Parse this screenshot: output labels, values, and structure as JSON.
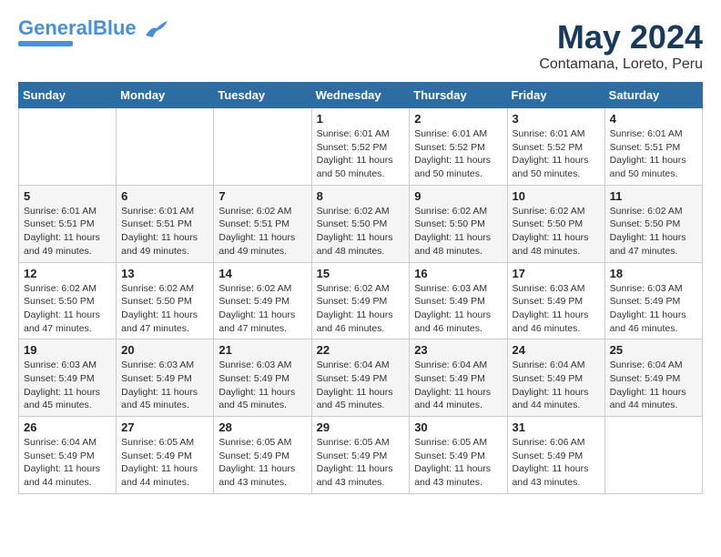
{
  "header": {
    "logo_general": "General",
    "logo_blue": "Blue",
    "month_title": "May 2024",
    "location": "Contamana, Loreto, Peru"
  },
  "days_of_week": [
    "Sunday",
    "Monday",
    "Tuesday",
    "Wednesday",
    "Thursday",
    "Friday",
    "Saturday"
  ],
  "weeks": [
    {
      "days": [
        {
          "num": "",
          "info": ""
        },
        {
          "num": "",
          "info": ""
        },
        {
          "num": "",
          "info": ""
        },
        {
          "num": "1",
          "info": "Sunrise: 6:01 AM\nSunset: 5:52 PM\nDaylight: 11 hours and 50 minutes."
        },
        {
          "num": "2",
          "info": "Sunrise: 6:01 AM\nSunset: 5:52 PM\nDaylight: 11 hours and 50 minutes."
        },
        {
          "num": "3",
          "info": "Sunrise: 6:01 AM\nSunset: 5:52 PM\nDaylight: 11 hours and 50 minutes."
        },
        {
          "num": "4",
          "info": "Sunrise: 6:01 AM\nSunset: 5:51 PM\nDaylight: 11 hours and 50 minutes."
        }
      ]
    },
    {
      "days": [
        {
          "num": "5",
          "info": "Sunrise: 6:01 AM\nSunset: 5:51 PM\nDaylight: 11 hours and 49 minutes."
        },
        {
          "num": "6",
          "info": "Sunrise: 6:01 AM\nSunset: 5:51 PM\nDaylight: 11 hours and 49 minutes."
        },
        {
          "num": "7",
          "info": "Sunrise: 6:02 AM\nSunset: 5:51 PM\nDaylight: 11 hours and 49 minutes."
        },
        {
          "num": "8",
          "info": "Sunrise: 6:02 AM\nSunset: 5:50 PM\nDaylight: 11 hours and 48 minutes."
        },
        {
          "num": "9",
          "info": "Sunrise: 6:02 AM\nSunset: 5:50 PM\nDaylight: 11 hours and 48 minutes."
        },
        {
          "num": "10",
          "info": "Sunrise: 6:02 AM\nSunset: 5:50 PM\nDaylight: 11 hours and 48 minutes."
        },
        {
          "num": "11",
          "info": "Sunrise: 6:02 AM\nSunset: 5:50 PM\nDaylight: 11 hours and 47 minutes."
        }
      ]
    },
    {
      "days": [
        {
          "num": "12",
          "info": "Sunrise: 6:02 AM\nSunset: 5:50 PM\nDaylight: 11 hours and 47 minutes."
        },
        {
          "num": "13",
          "info": "Sunrise: 6:02 AM\nSunset: 5:50 PM\nDaylight: 11 hours and 47 minutes."
        },
        {
          "num": "14",
          "info": "Sunrise: 6:02 AM\nSunset: 5:49 PM\nDaylight: 11 hours and 47 minutes."
        },
        {
          "num": "15",
          "info": "Sunrise: 6:02 AM\nSunset: 5:49 PM\nDaylight: 11 hours and 46 minutes."
        },
        {
          "num": "16",
          "info": "Sunrise: 6:03 AM\nSunset: 5:49 PM\nDaylight: 11 hours and 46 minutes."
        },
        {
          "num": "17",
          "info": "Sunrise: 6:03 AM\nSunset: 5:49 PM\nDaylight: 11 hours and 46 minutes."
        },
        {
          "num": "18",
          "info": "Sunrise: 6:03 AM\nSunset: 5:49 PM\nDaylight: 11 hours and 46 minutes."
        }
      ]
    },
    {
      "days": [
        {
          "num": "19",
          "info": "Sunrise: 6:03 AM\nSunset: 5:49 PM\nDaylight: 11 hours and 45 minutes."
        },
        {
          "num": "20",
          "info": "Sunrise: 6:03 AM\nSunset: 5:49 PM\nDaylight: 11 hours and 45 minutes."
        },
        {
          "num": "21",
          "info": "Sunrise: 6:03 AM\nSunset: 5:49 PM\nDaylight: 11 hours and 45 minutes."
        },
        {
          "num": "22",
          "info": "Sunrise: 6:04 AM\nSunset: 5:49 PM\nDaylight: 11 hours and 45 minutes."
        },
        {
          "num": "23",
          "info": "Sunrise: 6:04 AM\nSunset: 5:49 PM\nDaylight: 11 hours and 44 minutes."
        },
        {
          "num": "24",
          "info": "Sunrise: 6:04 AM\nSunset: 5:49 PM\nDaylight: 11 hours and 44 minutes."
        },
        {
          "num": "25",
          "info": "Sunrise: 6:04 AM\nSunset: 5:49 PM\nDaylight: 11 hours and 44 minutes."
        }
      ]
    },
    {
      "days": [
        {
          "num": "26",
          "info": "Sunrise: 6:04 AM\nSunset: 5:49 PM\nDaylight: 11 hours and 44 minutes."
        },
        {
          "num": "27",
          "info": "Sunrise: 6:05 AM\nSunset: 5:49 PM\nDaylight: 11 hours and 44 minutes."
        },
        {
          "num": "28",
          "info": "Sunrise: 6:05 AM\nSunset: 5:49 PM\nDaylight: 11 hours and 43 minutes."
        },
        {
          "num": "29",
          "info": "Sunrise: 6:05 AM\nSunset: 5:49 PM\nDaylight: 11 hours and 43 minutes."
        },
        {
          "num": "30",
          "info": "Sunrise: 6:05 AM\nSunset: 5:49 PM\nDaylight: 11 hours and 43 minutes."
        },
        {
          "num": "31",
          "info": "Sunrise: 6:06 AM\nSunset: 5:49 PM\nDaylight: 11 hours and 43 minutes."
        },
        {
          "num": "",
          "info": ""
        }
      ]
    }
  ]
}
